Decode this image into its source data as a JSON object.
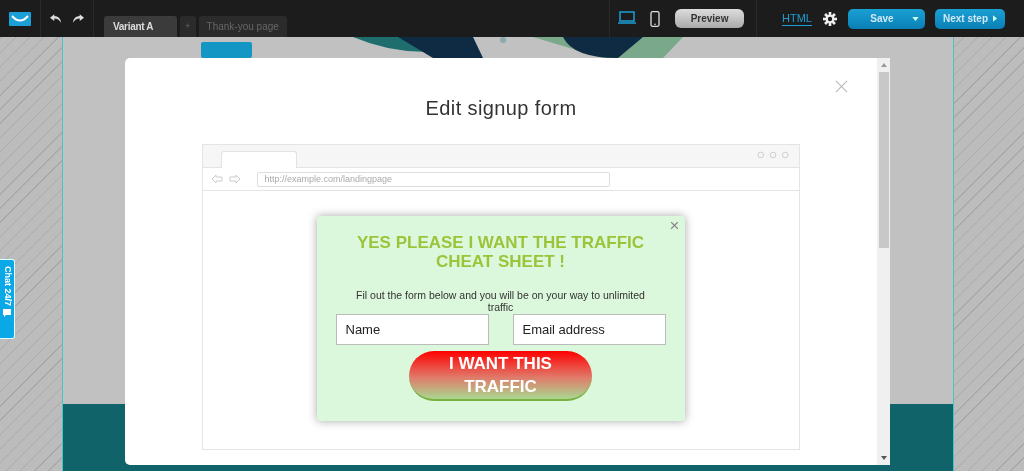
{
  "tabs": [
    {
      "label": "Variant A",
      "selected": true
    },
    {
      "label": "Thank-you page",
      "selected": false
    }
  ],
  "add_tab": "+",
  "devices": [
    {
      "kind": "desktop",
      "selected": true
    },
    {
      "kind": "mobile",
      "selected": false
    }
  ],
  "preview_button": "Preview",
  "html_link": "HTML",
  "save_button": "Save",
  "next_button": "Next step",
  "chat_tab": "Chat 24/7",
  "modal": {
    "title": "Edit signup form",
    "browser": {
      "url": "http://example.com/landingpage"
    },
    "popup": {
      "close": "×",
      "headline": "YES PLEASE I WANT THE TRAFFIC CHEAT SHEET !",
      "subtext": "Fil out the form below and you will be on your way to unlimited traffic",
      "fields": [
        {
          "placeholder": "Name"
        },
        {
          "placeholder": "Email address"
        }
      ],
      "button": "I WANT THIS TRAFFIC"
    }
  }
}
